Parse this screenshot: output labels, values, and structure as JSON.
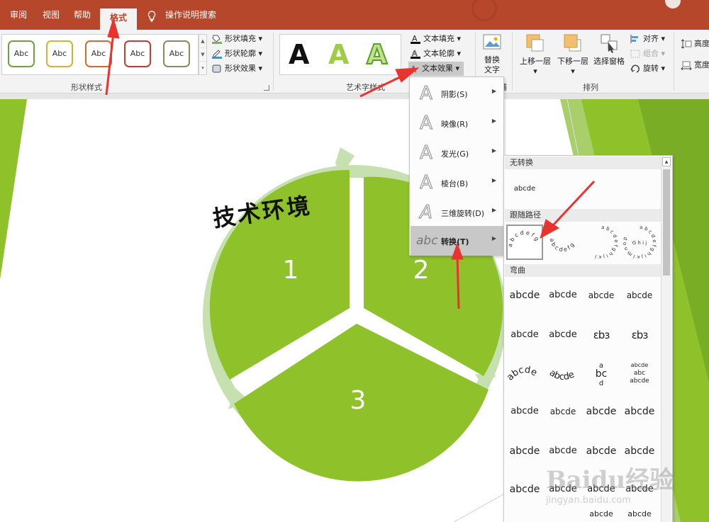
{
  "tabs": {
    "review": "审阅",
    "view": "视图",
    "help": "帮助",
    "format": "格式",
    "search": "操作说明搜索"
  },
  "ribbon": {
    "shape_styles": {
      "gallery": [
        "Abc",
        "Abc",
        "Abc",
        "Abc",
        "Abc"
      ],
      "fill": "形状填充",
      "outline": "形状轮廓",
      "effect": "形状效果",
      "label": "形状样式"
    },
    "wordart": {
      "samples": [
        "A",
        "A",
        "A"
      ],
      "text_fill": "文本填充",
      "text_outline": "文本轮廓",
      "text_effect": "文本效果",
      "label": "艺术字样式"
    },
    "alt_text": {
      "line1": "替换",
      "line2": "文字"
    },
    "arrange": {
      "bring_forward": "上移一层",
      "send_backward": "下移一层",
      "selection_pane": "选择窗格",
      "align": "对齐",
      "group": "组合",
      "rotate": "旋转",
      "label": "排列"
    },
    "size": {
      "height": "高度",
      "width": "宽度"
    }
  },
  "slide": {
    "handwritten": "技术环境",
    "segments": [
      "1",
      "2",
      "3"
    ]
  },
  "text_effect_menu": [
    {
      "label": "阴影(S)"
    },
    {
      "label": "映像(R)"
    },
    {
      "label": "发光(G)"
    },
    {
      "label": "棱台(B)"
    },
    {
      "label": "三维旋转(D)"
    },
    {
      "label": "转换(T)"
    }
  ],
  "transform_submenu": {
    "no_transform": "无转换",
    "no_transform_sample": "abcde",
    "follow_path": "跟随路径",
    "warp": "弯曲",
    "warp_sample": "abcde"
  },
  "watermark": {
    "logo": "Baidu经验",
    "url": "jingyan.baidu.com"
  },
  "colors": {
    "accent": "#b7472a",
    "slide_green": "#8fc12b",
    "ring_green": "#c6e0b0",
    "annotation_red": "#e8332f"
  }
}
